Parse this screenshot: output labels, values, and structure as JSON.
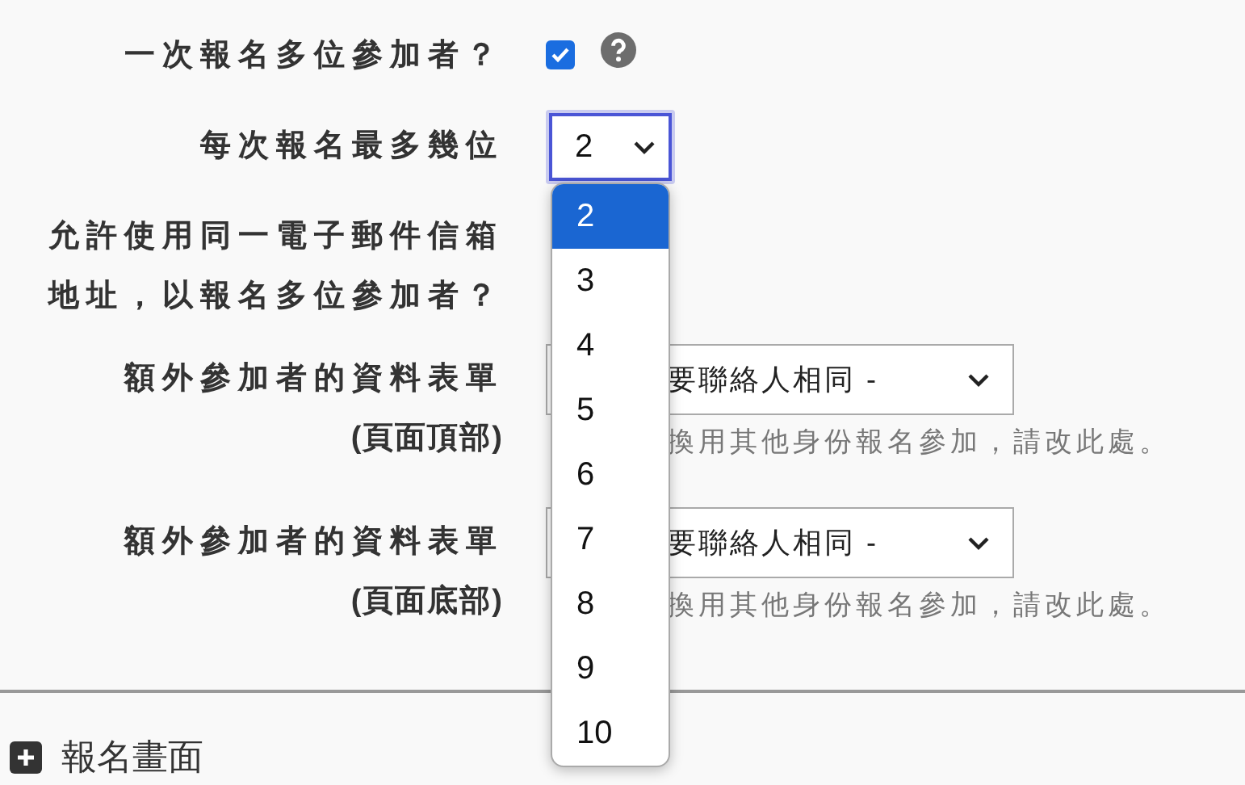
{
  "fields": [
    {
      "kind": "checkbox",
      "label": "一次報名多位參加者？",
      "checked": true,
      "help_icon": true
    },
    {
      "kind": "number-select",
      "label": "每次報名最多幾位",
      "value": "2"
    },
    {
      "kind": "text",
      "label": "允許使用同一電子郵件信箱地址，以報名多位參加者？"
    },
    {
      "kind": "select",
      "label": "額外參加者的資料表單",
      "label_note": "(頁面頂部)",
      "value": "要聯絡人相同 -",
      "help": "換用其他身份報名參加，請改此處。"
    },
    {
      "kind": "select",
      "label": "額外參加者的資料表單",
      "label_note": "(頁面底部)",
      "value": "要聯絡人相同 -",
      "help": "換用其他身份報名參加，請改此處。"
    }
  ],
  "dropdown": {
    "options": [
      {
        "label": "2",
        "selected": true
      },
      {
        "label": "3",
        "selected": false
      },
      {
        "label": "4",
        "selected": false
      },
      {
        "label": "5",
        "selected": false
      },
      {
        "label": "6",
        "selected": false
      },
      {
        "label": "7",
        "selected": false
      },
      {
        "label": "8",
        "selected": false
      },
      {
        "label": "9",
        "selected": false
      },
      {
        "label": "10",
        "selected": false
      }
    ]
  },
  "section": {
    "title": "報名畫面",
    "expanded": false
  }
}
